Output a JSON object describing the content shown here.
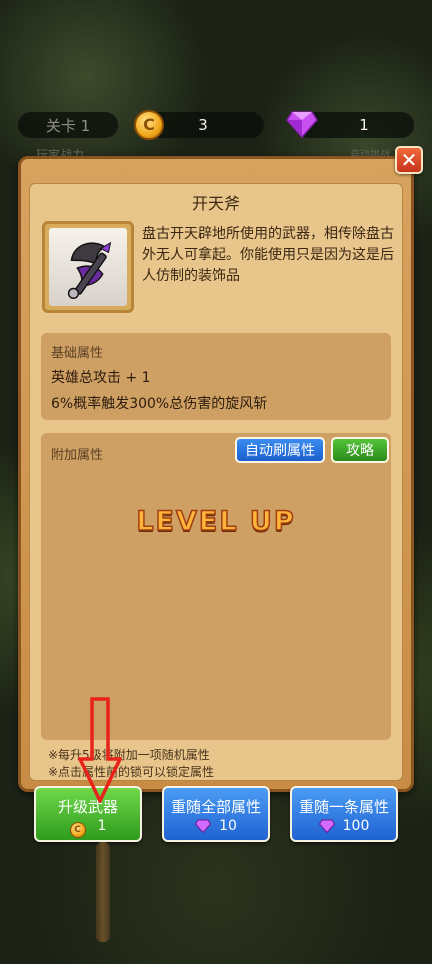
{
  "hud": {
    "level_label": "关卡 1",
    "coins": "3",
    "gems": "1",
    "left_behind_text": "玩家战力",
    "right_behind_text": "自动挑战"
  },
  "panel": {
    "title": "开天斧",
    "close_label": "✕",
    "item_icon": "battle-axe-icon",
    "description": "盘古开天辟地所使用的武器，相传除盘古外无人可拿起。你能使用只是因为这是后人仿制的装饰品",
    "base_attributes": {
      "title": "基础属性",
      "lines": [
        "英雄总攻击 + 1",
        "6%概率触发300%总伤害的旋风斩"
      ]
    },
    "extra_attributes": {
      "title": "附加属性",
      "auto_button": "自动刷属性",
      "guide_button": "攻略",
      "banner": "LEVEL UP"
    },
    "notes": [
      "※每升5级将附加一项随机属性",
      "※点击属性前的锁可以锁定属性"
    ]
  },
  "buttons": {
    "upgrade": {
      "label": "升级武器",
      "cost": "1",
      "currency_icon": "coin-icon"
    },
    "reroll_all": {
      "label": "重随全部属性",
      "cost": "10",
      "currency_icon": "gem-icon"
    },
    "reroll_one": {
      "label": "重随一条属性",
      "cost": "100",
      "currency_icon": "gem-icon"
    }
  },
  "colors": {
    "panel": "#d7a35e",
    "gem": "#c04ee0",
    "arrow": "#e8231b"
  }
}
